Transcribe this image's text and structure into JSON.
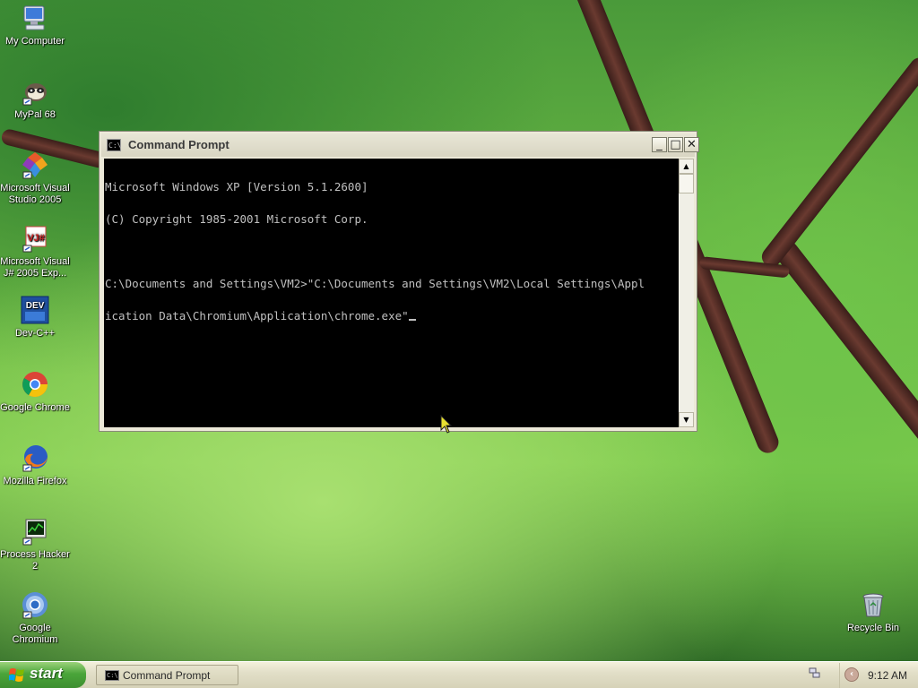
{
  "desktop": {
    "icons": [
      {
        "label": "My Computer",
        "icon": "my-computer-icon"
      },
      {
        "label": "MyPal 68",
        "icon": "mypal-icon"
      },
      {
        "label": "Microsoft Visual Studio 2005",
        "icon": "visual-studio-icon"
      },
      {
        "label": "Microsoft Visual J# 2005 Exp...",
        "icon": "visual-jsharp-icon"
      },
      {
        "label": "Dev-C++",
        "icon": "dev-cpp-icon"
      },
      {
        "label": "Google Chrome",
        "icon": "chrome-icon"
      },
      {
        "label": "Mozilla Firefox",
        "icon": "firefox-icon"
      },
      {
        "label": "Process Hacker 2",
        "icon": "process-hacker-icon"
      },
      {
        "label": "Google Chromium",
        "icon": "chromium-icon"
      },
      {
        "label": "Recycle Bin",
        "icon": "recycle-bin-icon"
      }
    ]
  },
  "window": {
    "title": "Command Prompt",
    "icon_text": "C:\\",
    "minimize_glyph": "_",
    "maximize_glyph": "□",
    "close_glyph": "✕",
    "console_lines": [
      "Microsoft Windows XP [Version 5.1.2600]",
      "(C) Copyright 1985-2001 Microsoft Corp.",
      "",
      "C:\\Documents and Settings\\VM2>\"C:\\Documents and Settings\\VM2\\Local Settings\\Appl",
      "ication Data\\Chromium\\Application\\chrome.exe\""
    ],
    "scroll_up_glyph": "▲",
    "scroll_down_glyph": "▼"
  },
  "taskbar": {
    "start_label": "start",
    "tasks": [
      {
        "label": "Command Prompt",
        "icon": "command-prompt-icon",
        "icon_text": "C:\\"
      }
    ],
    "tray_expand_glyph": "‹",
    "clock": "9:12 AM"
  },
  "colors": {
    "console_bg": "#000000",
    "console_fg": "#c0c0c0",
    "start_green": "#3d8f30",
    "taskbar_bg": "#e2dfc8"
  }
}
